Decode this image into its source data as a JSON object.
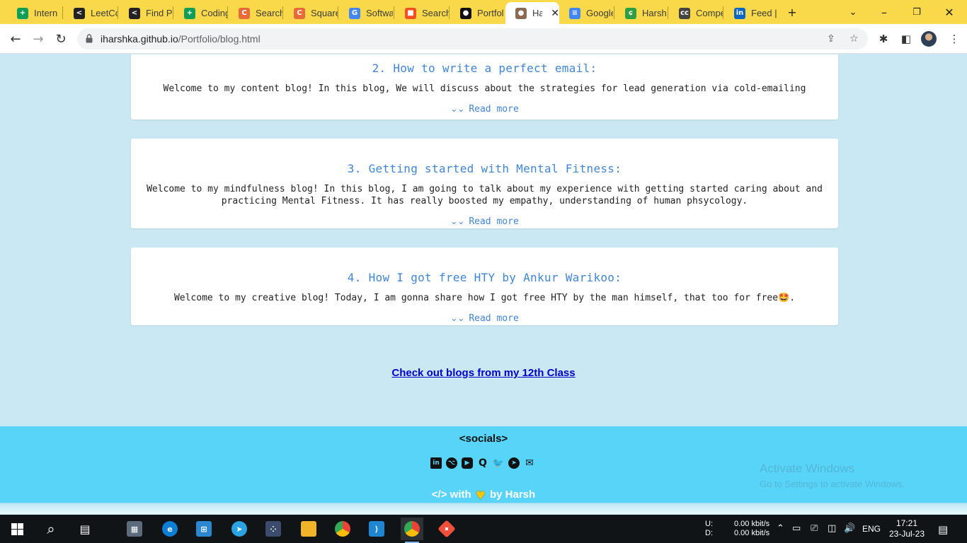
{
  "browser": {
    "tabs": [
      {
        "title": "Intern",
        "icon": "sheets-icon",
        "color": "#0f9d58",
        "glyph": "+"
      },
      {
        "title": "LeetCo",
        "icon": "leetcode-icon",
        "color": "#222222",
        "glyph": "<"
      },
      {
        "title": "Find Pi",
        "icon": "leetcode-icon",
        "color": "#222222",
        "glyph": "<"
      },
      {
        "title": "Coding",
        "icon": "sheets-icon",
        "color": "#0f9d58",
        "glyph": "+"
      },
      {
        "title": "Search",
        "icon": "codechef-icon",
        "color": "#e86a3a",
        "glyph": "C"
      },
      {
        "title": "Square",
        "icon": "codechef-icon",
        "color": "#e86a3a",
        "glyph": "C"
      },
      {
        "title": "Softwa",
        "icon": "google-icon",
        "color": "#4285f4",
        "glyph": "G"
      },
      {
        "title": "Search",
        "icon": "microsoft-icon",
        "color": "#f25022",
        "glyph": "■"
      },
      {
        "title": "Portfol",
        "icon": "github-icon",
        "color": "#111111",
        "glyph": "●"
      },
      {
        "title": "Har",
        "icon": "profile-icon",
        "color": "#8a6b52",
        "glyph": "●"
      },
      {
        "title": "Google",
        "icon": "docs-icon",
        "color": "#4285f4",
        "glyph": "≡"
      },
      {
        "title": "Harsh",
        "icon": "leaf-icon",
        "color": "#2e9e44",
        "glyph": "ɕ"
      },
      {
        "title": "Compe",
        "icon": "cc-icon",
        "color": "#444444",
        "glyph": "cc"
      },
      {
        "title": "Feed |",
        "icon": "linkedin-icon",
        "color": "#0a66c2",
        "glyph": "in"
      }
    ],
    "url_host": "iharshka.github.io",
    "url_path": "/Portfolio/blog.html"
  },
  "blogs": [
    {
      "title": "2. How to write a perfect email:",
      "excerpt": "Welcome to my content blog! In this blog, We will discuss about the strategies for lead generation via cold-emailing",
      "more": "Read more"
    },
    {
      "title": "3. Getting started with Mental Fitness:",
      "excerpt": "Welcome to my mindfulness blog! In this blog, I am going to talk about my experience with getting started caring about and practicing Mental Fitness. It has really boosted my empathy, understanding of human phsycology.",
      "more": "Read more"
    },
    {
      "title": "4. How I got free HTY by Ankur Warikoo:",
      "excerpt": "Welcome to my creative blog! Today, I am gonna share how I got free HTY by the man himself, that too for free🤩.",
      "more": "Read more"
    }
  ],
  "link_12th": "Check out blogs from my 12th Class",
  "footer": {
    "socials_title": "<socials>",
    "credit_pre": "</> with",
    "credit_post": "by Harsh",
    "social_icons": [
      "linkedin-icon",
      "github-icon",
      "youtube-icon",
      "quora-icon",
      "twitter-icon",
      "telegram-icon",
      "email-icon"
    ]
  },
  "watermark": {
    "line1": "Activate Windows",
    "line2": "Go to Settings to activate Windows."
  },
  "taskbar": {
    "net_u_label": "U:",
    "net_d_label": "D:",
    "net_u": "0.00 kbit/s",
    "net_d": "0.00 kbit/s",
    "lang": "ENG",
    "time": "17:21",
    "date": "23-Jul-23"
  }
}
